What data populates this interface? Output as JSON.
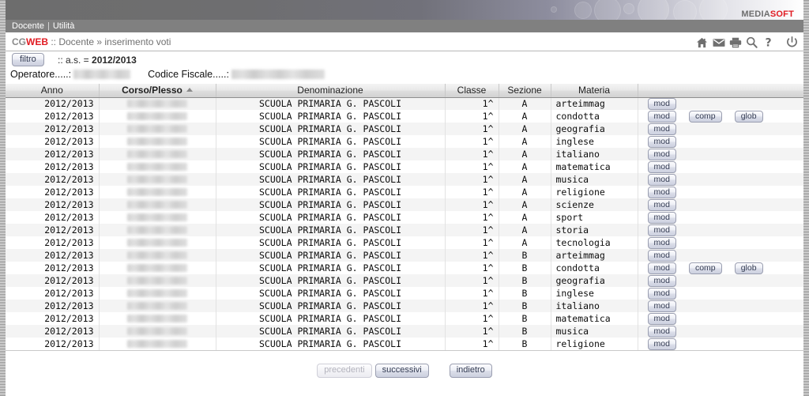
{
  "banner": {
    "brand_media": "MEDIA",
    "brand_soft": "SOFT"
  },
  "menubar": {
    "items": [
      "Docente",
      "Utilità"
    ],
    "separator": "|"
  },
  "breadcrumb": {
    "app_cg": "CG",
    "app_web": "WEB",
    "path": " :: Docente » inserimento voti"
  },
  "iconbar": {
    "icons": [
      {
        "name": "home-icon",
        "title": "home"
      },
      {
        "name": "mail-icon",
        "title": "mail"
      },
      {
        "name": "print-icon",
        "title": "stampa"
      },
      {
        "name": "search-icon",
        "title": "cerca"
      },
      {
        "name": "help-icon",
        "title": "?"
      },
      {
        "name": "power-icon",
        "title": "esci"
      }
    ]
  },
  "filter": {
    "button_label": "filtro",
    "prefix": ":: a.s. = ",
    "anno_scolastico": "2012/2013"
  },
  "operator": {
    "operatore_label": "Operatore.....:",
    "operatore_value": "",
    "codice_fiscale_label": "Codice Fiscale.....:",
    "codice_fiscale_value": ""
  },
  "table": {
    "columns": [
      {
        "key": "anno",
        "label": "Anno",
        "sorted": false
      },
      {
        "key": "corso",
        "label": "Corso/Plesso",
        "sorted": true,
        "sort_dir": "asc"
      },
      {
        "key": "denom",
        "label": "Denominazione",
        "sorted": false
      },
      {
        "key": "classe",
        "label": "Classe",
        "sorted": false
      },
      {
        "key": "sezione",
        "label": "Sezione",
        "sorted": false
      },
      {
        "key": "materia",
        "label": "Materia",
        "sorted": false
      },
      {
        "key": "azioni",
        "label": "",
        "sorted": false
      }
    ],
    "button_labels": {
      "mod": "mod",
      "comp": "comp",
      "glob": "glob"
    },
    "rows": [
      {
        "anno": "2012/2013",
        "corso": "",
        "denom": "SCUOLA PRIMARIA G. PASCOLI",
        "classe": "1^",
        "sezione": "A",
        "materia": "arteimmag",
        "azioni": [
          "mod"
        ]
      },
      {
        "anno": "2012/2013",
        "corso": "",
        "denom": "SCUOLA PRIMARIA G. PASCOLI",
        "classe": "1^",
        "sezione": "A",
        "materia": "condotta",
        "azioni": [
          "mod",
          "comp",
          "glob"
        ]
      },
      {
        "anno": "2012/2013",
        "corso": "",
        "denom": "SCUOLA PRIMARIA G. PASCOLI",
        "classe": "1^",
        "sezione": "A",
        "materia": "geografia",
        "azioni": [
          "mod"
        ]
      },
      {
        "anno": "2012/2013",
        "corso": "",
        "denom": "SCUOLA PRIMARIA G. PASCOLI",
        "classe": "1^",
        "sezione": "A",
        "materia": "inglese",
        "azioni": [
          "mod"
        ]
      },
      {
        "anno": "2012/2013",
        "corso": "",
        "denom": "SCUOLA PRIMARIA G. PASCOLI",
        "classe": "1^",
        "sezione": "A",
        "materia": "italiano",
        "azioni": [
          "mod"
        ]
      },
      {
        "anno": "2012/2013",
        "corso": "",
        "denom": "SCUOLA PRIMARIA G. PASCOLI",
        "classe": "1^",
        "sezione": "A",
        "materia": "matematica",
        "azioni": [
          "mod"
        ]
      },
      {
        "anno": "2012/2013",
        "corso": "",
        "denom": "SCUOLA PRIMARIA G. PASCOLI",
        "classe": "1^",
        "sezione": "A",
        "materia": "musica",
        "azioni": [
          "mod"
        ]
      },
      {
        "anno": "2012/2013",
        "corso": "",
        "denom": "SCUOLA PRIMARIA G. PASCOLI",
        "classe": "1^",
        "sezione": "A",
        "materia": "religione",
        "azioni": [
          "mod"
        ]
      },
      {
        "anno": "2012/2013",
        "corso": "",
        "denom": "SCUOLA PRIMARIA G. PASCOLI",
        "classe": "1^",
        "sezione": "A",
        "materia": "scienze",
        "azioni": [
          "mod"
        ]
      },
      {
        "anno": "2012/2013",
        "corso": "",
        "denom": "SCUOLA PRIMARIA G. PASCOLI",
        "classe": "1^",
        "sezione": "A",
        "materia": "sport",
        "azioni": [
          "mod"
        ]
      },
      {
        "anno": "2012/2013",
        "corso": "",
        "denom": "SCUOLA PRIMARIA G. PASCOLI",
        "classe": "1^",
        "sezione": "A",
        "materia": "storia",
        "azioni": [
          "mod"
        ]
      },
      {
        "anno": "2012/2013",
        "corso": "",
        "denom": "SCUOLA PRIMARIA G. PASCOLI",
        "classe": "1^",
        "sezione": "A",
        "materia": "tecnologia",
        "azioni": [
          "mod"
        ]
      },
      {
        "anno": "2012/2013",
        "corso": "",
        "denom": "SCUOLA PRIMARIA G. PASCOLI",
        "classe": "1^",
        "sezione": "B",
        "materia": "arteimmag",
        "azioni": [
          "mod"
        ]
      },
      {
        "anno": "2012/2013",
        "corso": "",
        "denom": "SCUOLA PRIMARIA G. PASCOLI",
        "classe": "1^",
        "sezione": "B",
        "materia": "condotta",
        "azioni": [
          "mod",
          "comp",
          "glob"
        ]
      },
      {
        "anno": "2012/2013",
        "corso": "",
        "denom": "SCUOLA PRIMARIA G. PASCOLI",
        "classe": "1^",
        "sezione": "B",
        "materia": "geografia",
        "azioni": [
          "mod"
        ]
      },
      {
        "anno": "2012/2013",
        "corso": "",
        "denom": "SCUOLA PRIMARIA G. PASCOLI",
        "classe": "1^",
        "sezione": "B",
        "materia": "inglese",
        "azioni": [
          "mod"
        ]
      },
      {
        "anno": "2012/2013",
        "corso": "",
        "denom": "SCUOLA PRIMARIA G. PASCOLI",
        "classe": "1^",
        "sezione": "B",
        "materia": "italiano",
        "azioni": [
          "mod"
        ]
      },
      {
        "anno": "2012/2013",
        "corso": "",
        "denom": "SCUOLA PRIMARIA G. PASCOLI",
        "classe": "1^",
        "sezione": "B",
        "materia": "matematica",
        "azioni": [
          "mod"
        ]
      },
      {
        "anno": "2012/2013",
        "corso": "",
        "denom": "SCUOLA PRIMARIA G. PASCOLI",
        "classe": "1^",
        "sezione": "B",
        "materia": "musica",
        "azioni": [
          "mod"
        ]
      },
      {
        "anno": "2012/2013",
        "corso": "",
        "denom": "SCUOLA PRIMARIA G. PASCOLI",
        "classe": "1^",
        "sezione": "B",
        "materia": "religione",
        "azioni": [
          "mod"
        ]
      }
    ]
  },
  "pager": {
    "prev_label": "precedenti",
    "prev_disabled": true,
    "next_label": "successivi",
    "next_disabled": false,
    "back_label": "indietro",
    "back_disabled": false
  },
  "colors": {
    "brand_red": "#e11b22",
    "banner_dark": "#6d6d6d",
    "menubar": "#808080",
    "row_odd": "#f4f4f4",
    "row_even": "#ffffff",
    "header_border": "#8f8f8f"
  }
}
